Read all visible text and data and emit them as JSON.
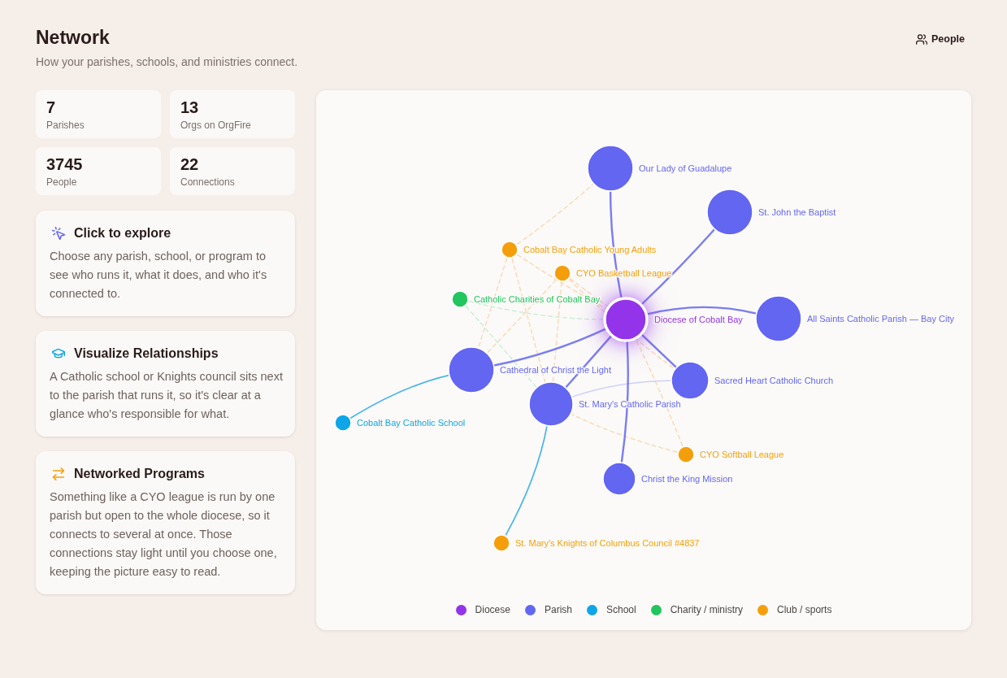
{
  "header": {
    "title": "Network",
    "subtitle": "How your parishes, schools, and ministries connect."
  },
  "people_button": {
    "label": "People"
  },
  "stats": [
    {
      "value": "7",
      "label": "Parishes"
    },
    {
      "value": "13",
      "label": "Orgs on OrgFire"
    },
    {
      "value": "3745",
      "label": "People"
    },
    {
      "value": "22",
      "label": "Connections"
    }
  ],
  "info_cards": [
    {
      "kind": "explore",
      "title": "Click to explore",
      "text": "Choose any parish, school, or program to see who runs it, what it does, and who it's connected to."
    },
    {
      "kind": "relationships",
      "title": "Visualize Relationships",
      "text": "A Catholic school or Knights council sits next to the parish that runs it, so it's clear at a glance who's responsible for what."
    },
    {
      "kind": "programs",
      "title": "Networked Programs",
      "text": "Something like a CYO league is run by one parish but open to the whole diocese, so it connects to several at once. Those connections stay light until you choose one, keeping the picture easy to read."
    }
  ],
  "network": {
    "nodes": [
      {
        "label": "Our Lady of Guadalupe",
        "kind": "parish"
      },
      {
        "label": "St. John the Baptist",
        "kind": "parish"
      },
      {
        "label": "Cobalt Bay Catholic Young Adults",
        "kind": "club"
      },
      {
        "label": "CYO Basketball League",
        "kind": "club"
      },
      {
        "label": "Catholic Charities of Cobalt Bay",
        "kind": "charity"
      },
      {
        "label": "Diocese of Cobalt Bay",
        "kind": "diocese"
      },
      {
        "label": "All Saints Catholic Parish — Bay City",
        "kind": "parish"
      },
      {
        "label": "Cathedral of Christ the Light",
        "kind": "parish"
      },
      {
        "label": "Sacred Heart Catholic Church",
        "kind": "parish"
      },
      {
        "label": "St. Mary's Catholic Parish",
        "kind": "parish"
      },
      {
        "label": "Cobalt Bay Catholic School",
        "kind": "school"
      },
      {
        "label": "CYO Softball League",
        "kind": "club"
      },
      {
        "label": "Christ the King Mission",
        "kind": "parish"
      },
      {
        "label": "St. Mary's Knights of Columbus Council #4837",
        "kind": "club"
      }
    ],
    "legend": [
      {
        "kind": "diocese",
        "label": "Diocese",
        "color": "#9333ea"
      },
      {
        "kind": "parish",
        "label": "Parish",
        "color": "#6366f1"
      },
      {
        "kind": "school",
        "label": "School",
        "color": "#0ea5e9"
      },
      {
        "kind": "charity",
        "label": "Charity / ministry",
        "color": "#22c55e"
      },
      {
        "kind": "club",
        "label": "Club / sports",
        "color": "#f59e0b"
      }
    ]
  }
}
